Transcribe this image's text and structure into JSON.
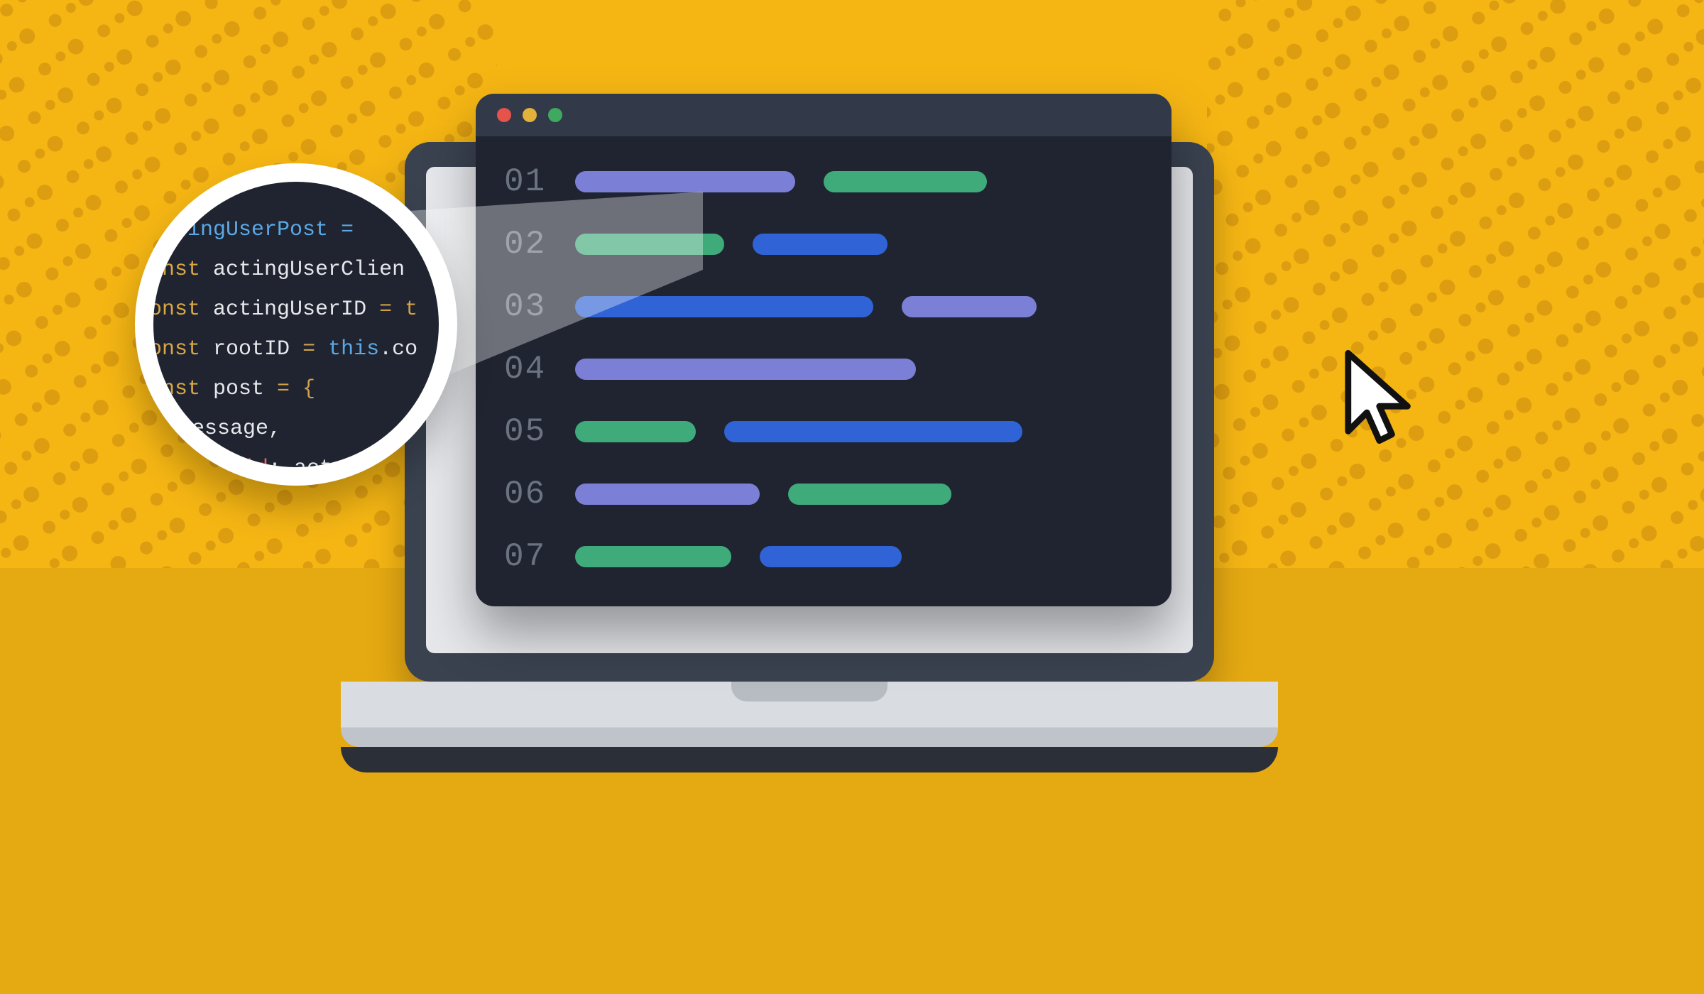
{
  "colors": {
    "background": "#f5b614",
    "floor": "#e5a912",
    "window_bg": "#1f2430",
    "titlebar_bg": "#323a49",
    "line_number": "#6b7280",
    "bar_purple": "#7b7fd6",
    "bar_green": "#3faa7a",
    "bar_blue": "#2f63d6",
    "traffic_red": "#e5534b",
    "traffic_yellow": "#e2b23a",
    "traffic_green": "#3fa95f"
  },
  "code_lines": {
    "l1": "01",
    "l2": "02",
    "l3": "03",
    "l4": "04",
    "l5": "05",
    "l6": "06",
    "l7": "07"
  },
  "magnifier_code": {
    "line1_frag": "eActingUserPost =",
    "line2_kw": "const",
    "line2_id": "actingUserClien",
    "line3_kw": "const",
    "line3_id": "actingUserID",
    "line3_eq": " = t",
    "line4_kw": "const",
    "line4_id": "rootID",
    "line4_eq": " = ",
    "line4_this": "this",
    "line4_dot": ".co",
    "line5_kw": "const",
    "line5_id": "post",
    "line5_eq": " = {",
    "line6_indent": "message,",
    "line7_field": "user_id",
    "line7_rest": ": act"
  }
}
